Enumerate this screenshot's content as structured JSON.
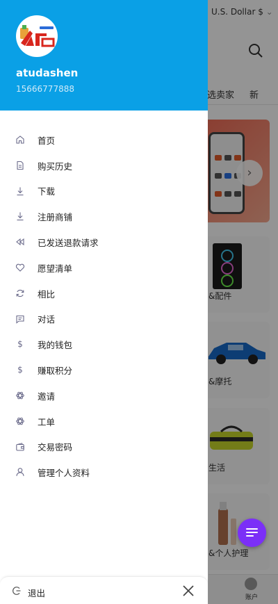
{
  "background": {
    "currency": "U.S. Dollar $",
    "tabs": [
      "选卖家",
      "新"
    ],
    "categories": [
      "&配件",
      "&摩托",
      "生活",
      "&个人护理"
    ],
    "bottom_nav_account": "账户"
  },
  "drawer": {
    "header_color": "#0aa0e6",
    "username": "atudashen",
    "phone": "15666777888",
    "menu": [
      {
        "label": "首页",
        "icon": "home-icon"
      },
      {
        "label": "购买历史",
        "icon": "document-icon"
      },
      {
        "label": "下载",
        "icon": "download-icon"
      },
      {
        "label": "注册商铺",
        "icon": "download-icon"
      },
      {
        "label": "已发送退款请求",
        "icon": "rewind-icon"
      },
      {
        "label": "愿望清单",
        "icon": "heart-icon"
      },
      {
        "label": "相比",
        "icon": "refresh-icon"
      },
      {
        "label": "对话",
        "icon": "chat-icon"
      },
      {
        "label": "我的钱包",
        "icon": "dollar-icon"
      },
      {
        "label": "赚取积分",
        "icon": "dollar-icon"
      },
      {
        "label": "邀请",
        "icon": "openai-icon"
      },
      {
        "label": "工单",
        "icon": "openai-icon"
      },
      {
        "label": "交易密码",
        "icon": "wallet-icon"
      },
      {
        "label": "管理个人资料",
        "icon": "user-icon"
      }
    ],
    "logout_label": "退出"
  }
}
